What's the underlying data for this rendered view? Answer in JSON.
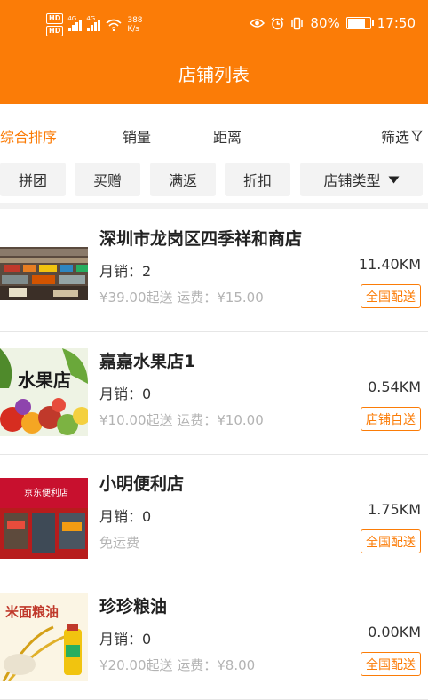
{
  "status_bar": {
    "hd1": "HD",
    "hd2": "HD",
    "net1": "4G",
    "net2": "4G",
    "speed_value": "388",
    "speed_unit": "K/s",
    "battery": "80%",
    "time": "17:50"
  },
  "header": {
    "title": "店铺列表"
  },
  "sort_bar": {
    "items": [
      "综合排序",
      "销量",
      "距离"
    ],
    "active_index": 0,
    "filter_label": "筛选"
  },
  "tags": [
    "拼团",
    "买赠",
    "满返",
    "折扣",
    "店铺类型"
  ],
  "stores": [
    {
      "name": "深圳市龙岗区四季祥和商店",
      "sales": "月销：2",
      "distance": "11.40KM",
      "fee": "¥39.00起送 运费：¥15.00",
      "badge": "全国配送",
      "thumb_text": ""
    },
    {
      "name": "嘉嘉水果店1",
      "sales": "月销：0",
      "distance": "0.54KM",
      "fee": "¥10.00起送 运费：¥10.00",
      "badge": "店铺自送",
      "thumb_text": "水果店"
    },
    {
      "name": "小明便利店",
      "sales": "月销：0",
      "distance": "1.75KM",
      "fee": "免运费",
      "badge": "全国配送",
      "thumb_text": "京东便利店"
    },
    {
      "name": "珍珍粮油",
      "sales": "月销：0",
      "distance": "0.00KM",
      "fee": "¥20.00起送 运费：¥8.00",
      "badge": "全国配送",
      "thumb_text": "米面粮油"
    }
  ],
  "colors": {
    "accent": "#fb7c07",
    "muted": "#b3b3b3"
  }
}
